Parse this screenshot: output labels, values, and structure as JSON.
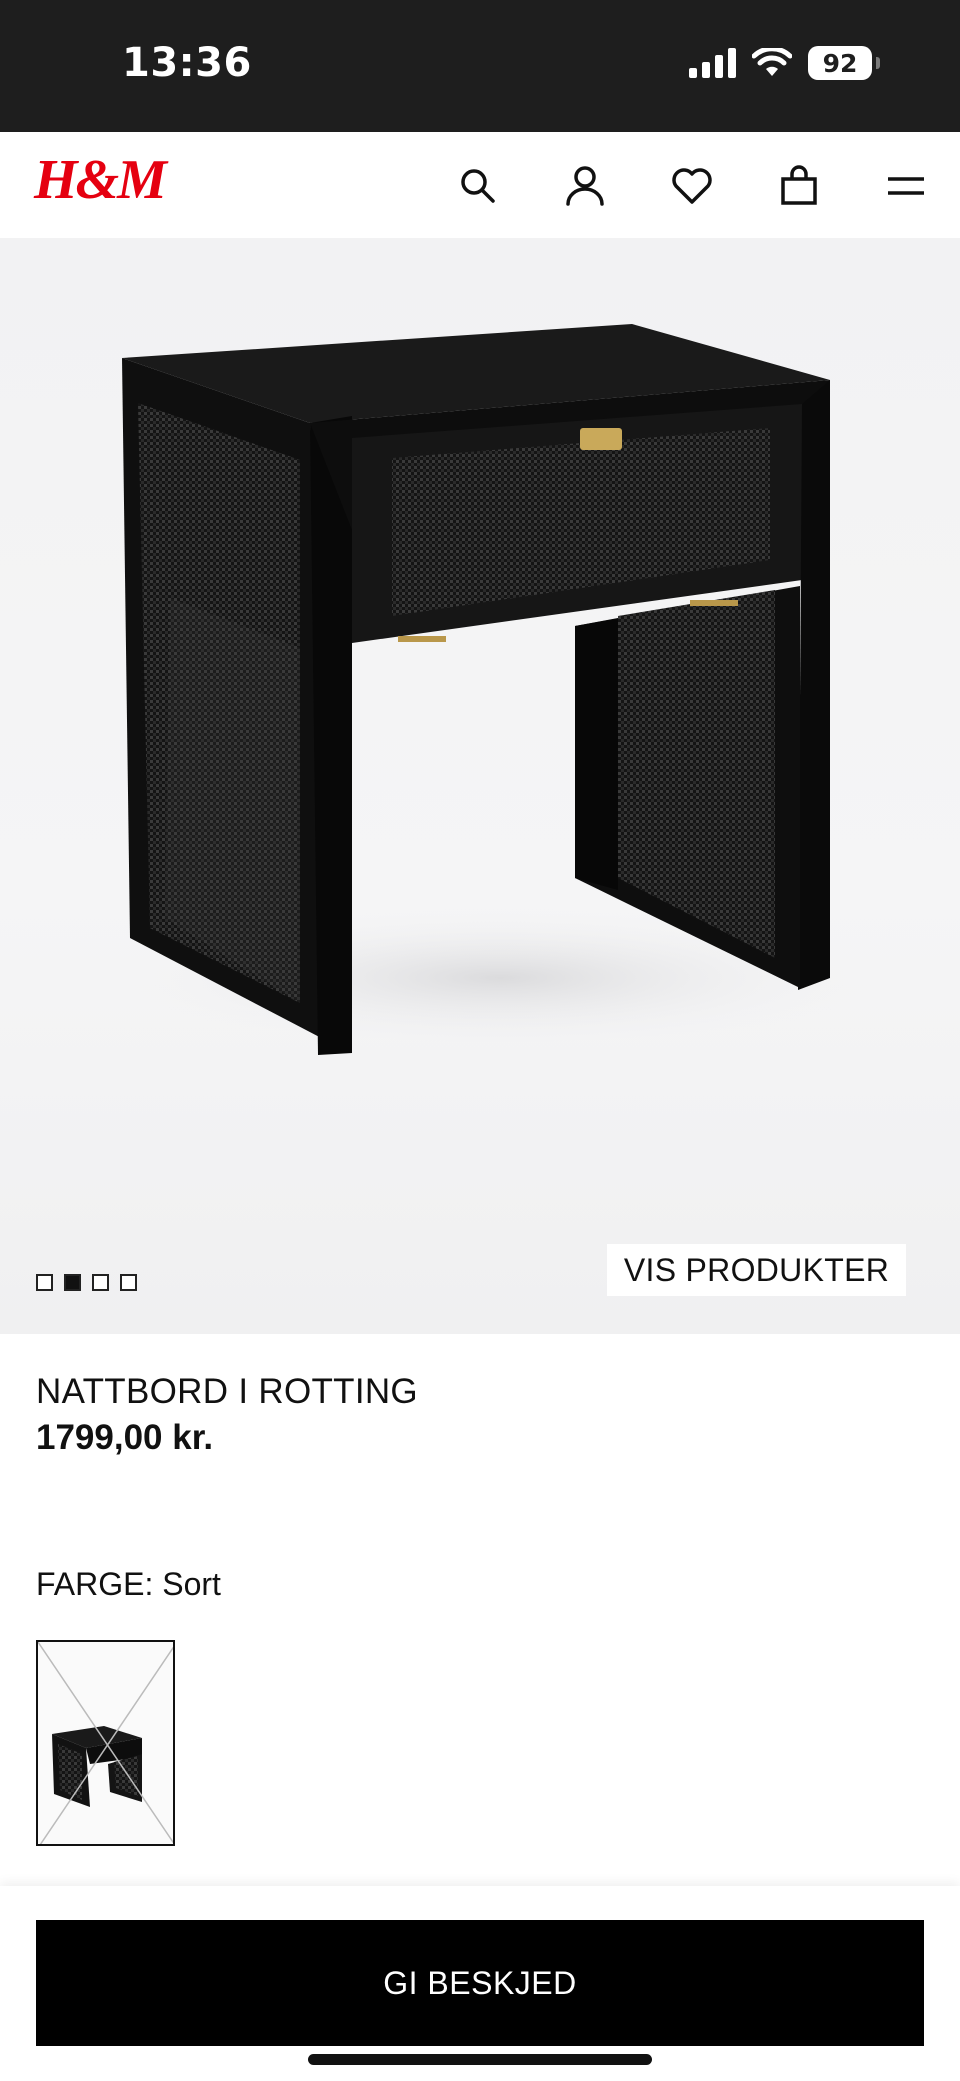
{
  "status_bar": {
    "time": "13:36",
    "battery": "92"
  },
  "header": {
    "logo": "H&M",
    "icons": [
      "search-icon",
      "account-icon",
      "favorites-icon",
      "shopping-bag-icon",
      "menu-icon"
    ]
  },
  "gallery": {
    "image_count": 4,
    "active_index": 1,
    "view_products_label": "VIS PRODUKTER"
  },
  "product": {
    "name": "NATTBORD I ROTTING",
    "price": "1799,00 kr.",
    "color_label": "FARGE: Sort"
  },
  "cta": {
    "label": "GI BESKJED"
  },
  "colors": {
    "brand": "#e50010",
    "cta_bg": "#000000",
    "status_bar_bg": "#1e1e1e"
  }
}
